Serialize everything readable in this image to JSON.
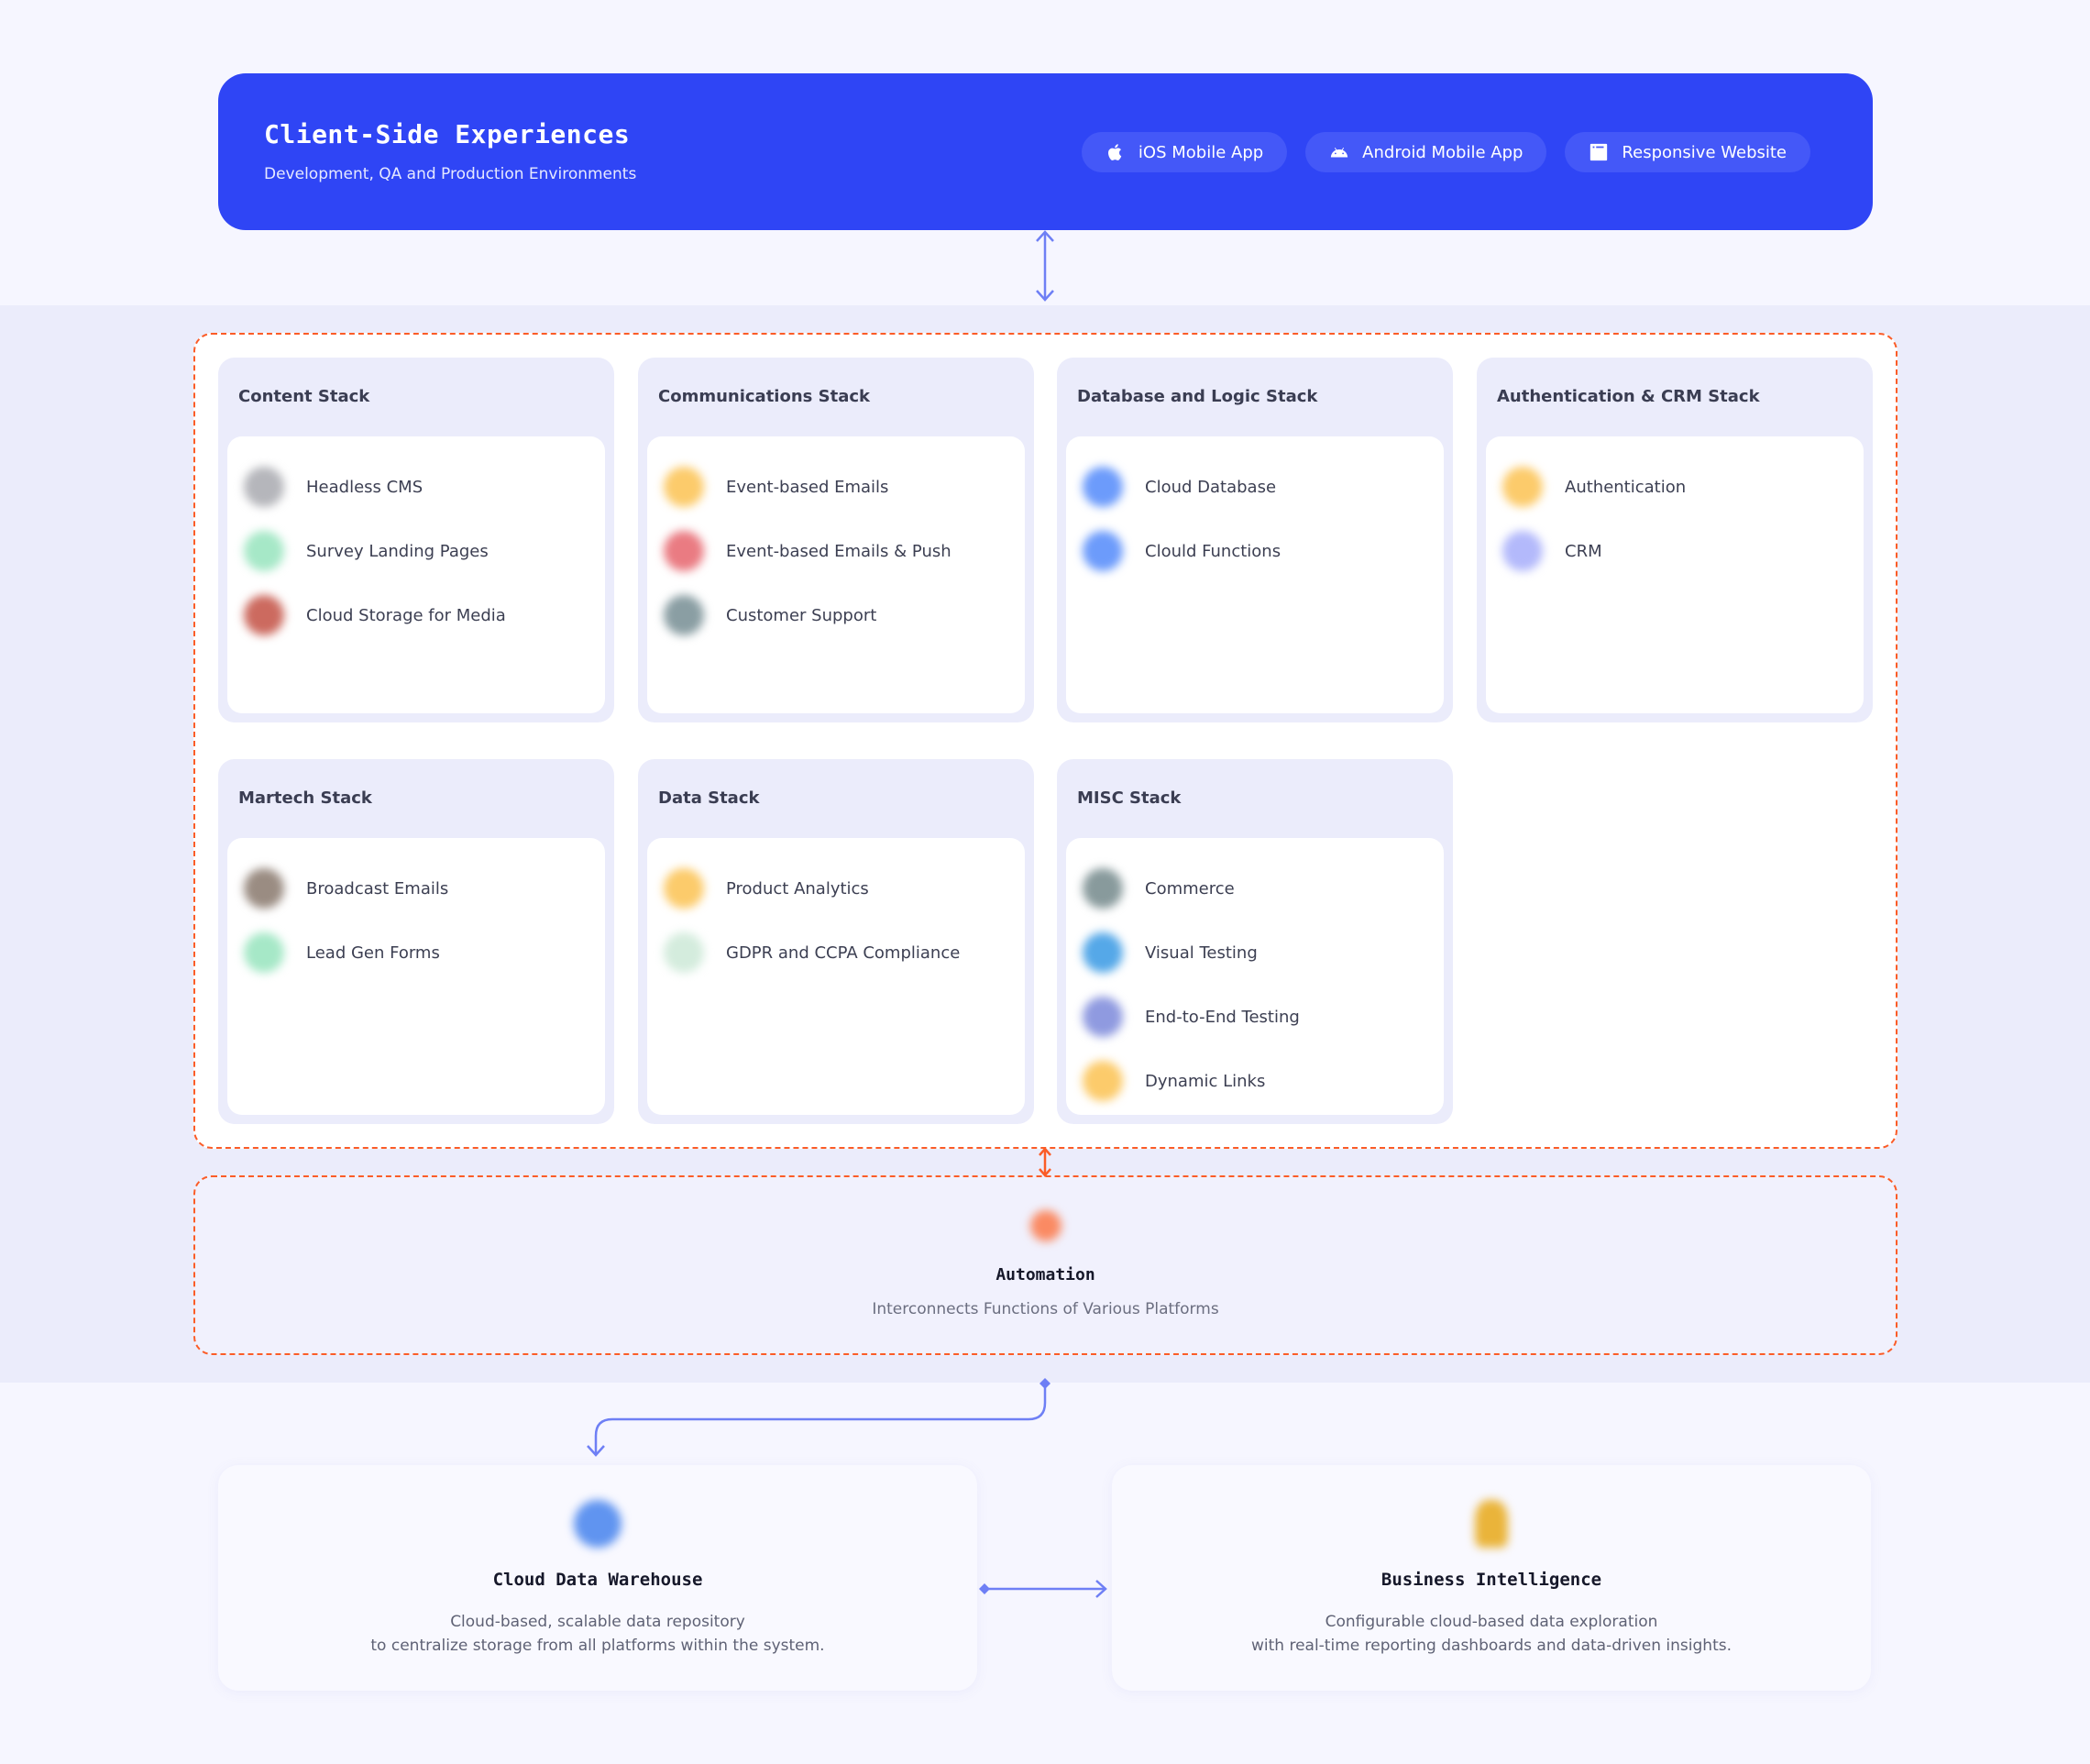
{
  "header": {
    "title": "Client-Side Experiences",
    "subtitle": "Development, QA and Production Environments",
    "platforms": [
      {
        "label": "iOS Mobile App",
        "icon": "apple-icon"
      },
      {
        "label": "Android Mobile App",
        "icon": "android-icon"
      },
      {
        "label": "Responsive Website",
        "icon": "browser-window-icon"
      }
    ]
  },
  "stacks": [
    {
      "title": "Content Stack",
      "items": [
        {
          "label": "Headless CMS",
          "color": "#b5b6bb"
        },
        {
          "label": "Survey Landing Pages",
          "color": "#a6e8c7"
        },
        {
          "label": "Cloud Storage for Media",
          "color": "#cc6a5f"
        }
      ]
    },
    {
      "title": "Communications Stack",
      "items": [
        {
          "label": "Event-based Emails",
          "color": "#fccb6b"
        },
        {
          "label": "Event-based Emails & Push",
          "color": "#ea7b82"
        },
        {
          "label": "Customer Support",
          "color": "#8a9ea3"
        }
      ]
    },
    {
      "title": "Database and Logic Stack",
      "items": [
        {
          "label": "Cloud Database",
          "color": "#6c9bfb"
        },
        {
          "label": "Clould Functions",
          "color": "#6c9bfb"
        }
      ]
    },
    {
      "title": "Authentication & CRM Stack",
      "items": [
        {
          "label": "Authentication",
          "color": "#fccb6b"
        },
        {
          "label": "CRM",
          "color": "#b3b9fb"
        }
      ]
    },
    {
      "title": "Martech Stack",
      "items": [
        {
          "label": "Broadcast Emails",
          "color": "#9a8c82"
        },
        {
          "label": "Lead Gen Forms",
          "color": "#a6e8c7"
        }
      ]
    },
    {
      "title": "Data Stack",
      "items": [
        {
          "label": "Product Analytics",
          "color": "#fccb6b"
        },
        {
          "label": "GDPR and CCPA Compliance",
          "color": "#d4ecdd"
        }
      ]
    },
    {
      "title": "MISC Stack",
      "items": [
        {
          "label": "Commerce",
          "color": "#889a9c"
        },
        {
          "label": "Visual Testing",
          "color": "#55a8e8"
        },
        {
          "label": "End-to-End Testing",
          "color": "#8f9ae0"
        },
        {
          "label": "Dynamic Links",
          "color": "#fccb6b"
        }
      ]
    }
  ],
  "automation": {
    "title": "Automation",
    "subtitle": "Interconnects Functions of Various Platforms",
    "color": "#fa8a63"
  },
  "bottom": [
    {
      "title": "Cloud Data Warehouse",
      "line1": "Cloud-based, scalable data repository",
      "line2": "to centralize storage from all platforms within the system.",
      "color": "#6094f0"
    },
    {
      "title": "Business Intelligence",
      "line1": "Configurable cloud-based data exploration",
      "line2": "with real-time reporting dashboards and data-driven insights.",
      "color": "#eab43a"
    }
  ],
  "colors": {
    "brand": "#2f45f5",
    "connector": "#6e7ff5",
    "dashed_border": "#fb5c27"
  }
}
